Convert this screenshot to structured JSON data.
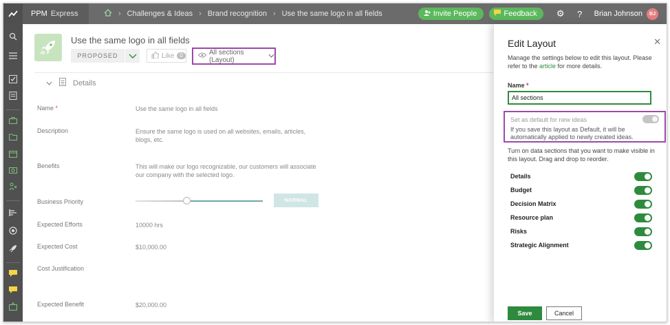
{
  "app": {
    "brand": "PPM",
    "product": "Express"
  },
  "breadcrumb": {
    "item1": "Challenges & Ideas",
    "item2": "Brand recognition",
    "item3": "Use the same logo in all fields"
  },
  "header": {
    "invite_label": "Invite People",
    "feedback_label": "Feedback",
    "user_name": "Brian Johnson",
    "user_initials": "BJ"
  },
  "idea": {
    "title": "Use the same logo in all fields",
    "status": "PROPOSED",
    "like_label": "Like",
    "like_count": "0",
    "layout_select": "All sections (Layout)"
  },
  "details": {
    "section_title": "Details",
    "fields": {
      "name_label": "Name",
      "name_value": "Use the same logo in all fields",
      "description_label": "Description",
      "description_value": "Ensure the same logo is used on all websites, emails, articles, blogs, etc.",
      "benefits_label": "Benefits",
      "benefits_value": "This will make our logo recognizable, our customers will associate our company with the selected logo.",
      "priority_label": "Business Priority",
      "priority_value": "NORMAL",
      "efforts_label": "Expected Efforts",
      "efforts_value": "10000 hrs",
      "cost_label": "Expected Cost",
      "cost_value": "$10,000.00",
      "justification_label": "Cost Justification",
      "benefit_label": "Expected Benefit",
      "benefit_value": "$20,000.00"
    }
  },
  "panel": {
    "title": "Edit Layout",
    "desc_before": "Manage the settings below to edit this layout. Please refer to the ",
    "desc_link": "article",
    "desc_after": " for more details.",
    "name_label": "Name",
    "name_value": "All sections",
    "default_label": "Set as default for new ideas",
    "default_note": "If you save this layout as Default, it will be automatically applied to newly created ideas.",
    "sections_hint": "Turn on data sections that you want to make visible in this layout. Drag and drop to reorder.",
    "sections": [
      {
        "label": "Details",
        "on": true
      },
      {
        "label": "Budget",
        "on": true
      },
      {
        "label": "Decision Matrix",
        "on": true
      },
      {
        "label": "Resource plan",
        "on": true
      },
      {
        "label": "Risks",
        "on": true
      },
      {
        "label": "Strategic Alignment",
        "on": true
      }
    ],
    "save_label": "Save",
    "cancel_label": "Cancel"
  },
  "colors": {
    "accent_green": "#2e8b3d",
    "highlight_purple": "#9b4aa8",
    "topbar_gray": "#6b6b6b",
    "rail_dark": "#505050"
  },
  "icons": [
    "logo-icon",
    "home-icon",
    "user-plus-icon",
    "feedback-icon",
    "gear-icon",
    "help-icon",
    "search-icon",
    "menu-icon",
    "tasks-icon",
    "notes-icon",
    "rocket-icon",
    "thumbs-up-icon",
    "eye-icon",
    "close-icon"
  ]
}
